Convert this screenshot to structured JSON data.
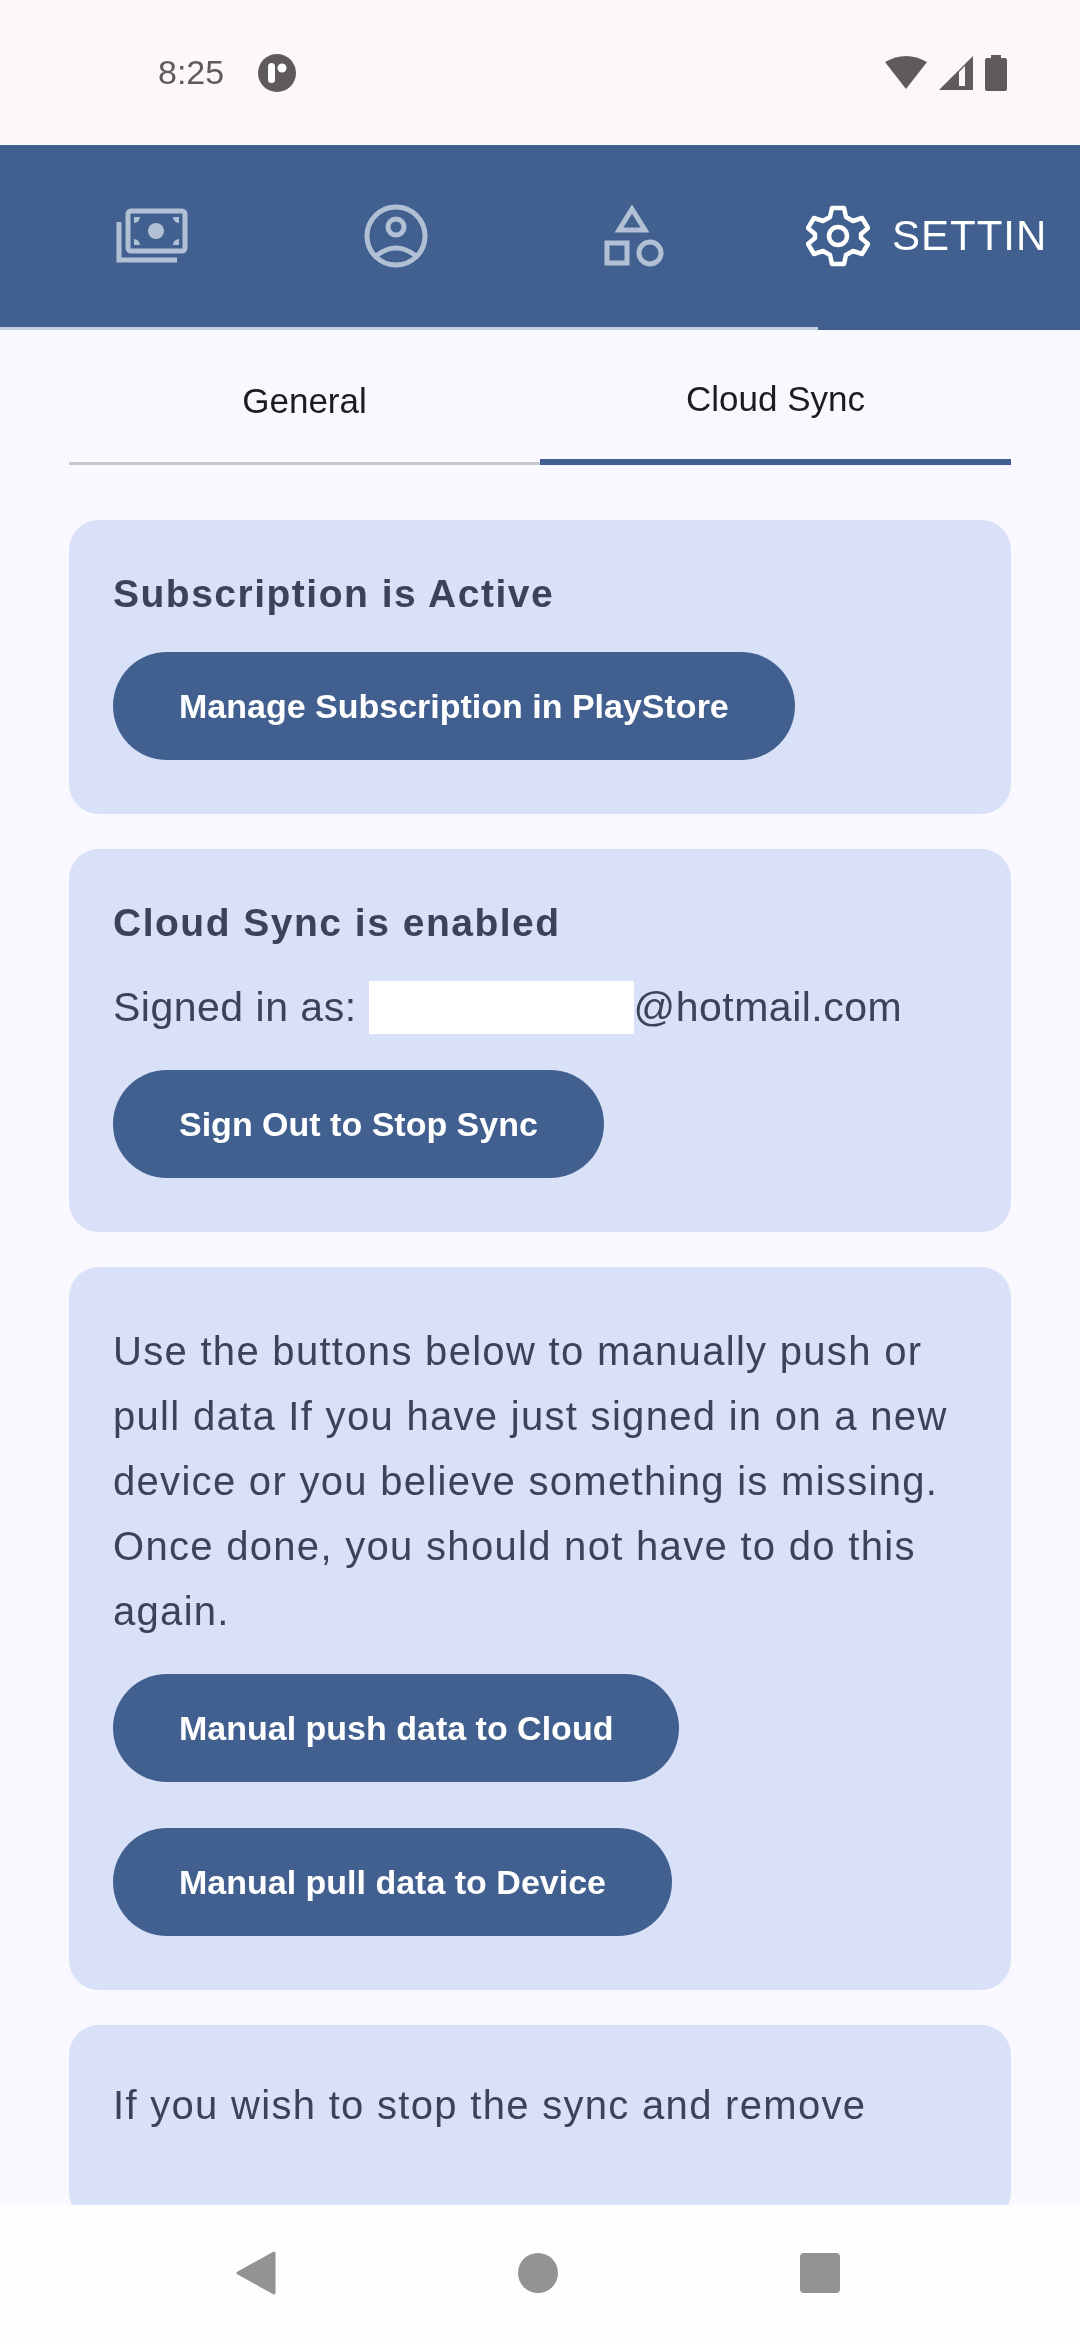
{
  "status_bar": {
    "time": "8:25"
  },
  "nav_tabs": [
    {
      "kind": "money",
      "selected": false
    },
    {
      "kind": "profile",
      "selected": false
    },
    {
      "kind": "shapes",
      "selected": false
    },
    {
      "kind": "settings",
      "label": "SETTIN",
      "selected": true
    }
  ],
  "sub_tabs": [
    {
      "label": "General",
      "selected": false
    },
    {
      "label": "Cloud Sync",
      "selected": true
    }
  ],
  "cards": [
    {
      "title": "Subscription is Active",
      "buttons": [
        "Manage Subscription in PlayStore"
      ]
    },
    {
      "title": "Cloud Sync is enabled",
      "signed_in_label": "Signed in as:",
      "email_domain": "@hotmail.com",
      "buttons": [
        "Sign Out to Stop Sync"
      ]
    },
    {
      "paragraphs": [
        "Use the buttons below to manually push or pull data If you have just signed in on a new device or you believe something is missing.",
        "Once done, you should not have to do this again."
      ],
      "buttons": [
        "Manual push data to Cloud",
        "Manual pull data to Device"
      ]
    },
    {
      "paragraphs": [
        "If you wish to stop the sync and remove"
      ]
    }
  ]
}
